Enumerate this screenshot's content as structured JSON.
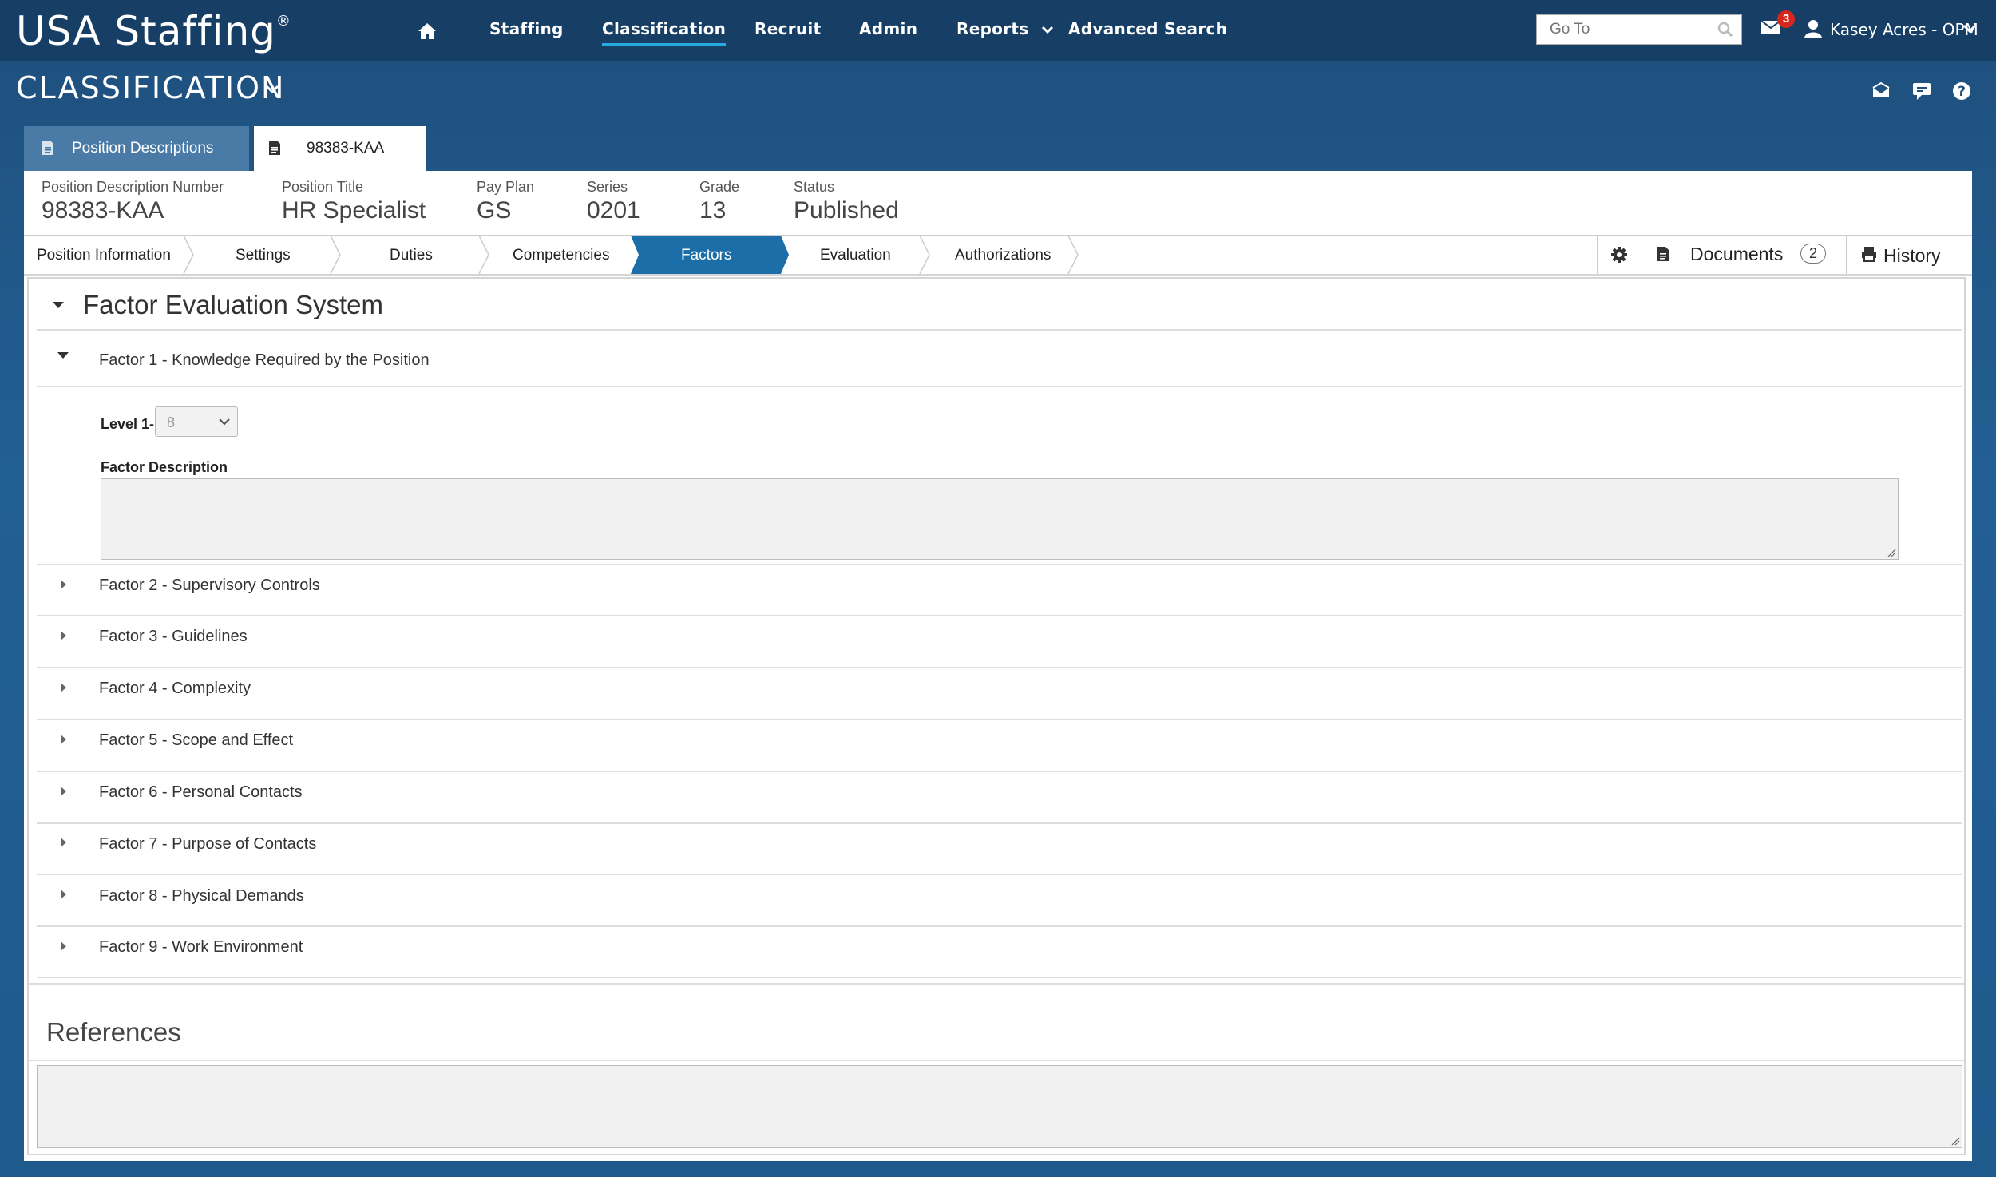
{
  "app": {
    "logo": "USA Staffing",
    "logo_mark": "®"
  },
  "nav": {
    "items": [
      "Staffing",
      "Classification",
      "Recruit",
      "Admin",
      "Reports",
      "Advanced Search"
    ],
    "active": "Classification",
    "goto_placeholder": "Go To",
    "notification_count": "3",
    "user": "Kasey Acres - OPM"
  },
  "module": {
    "title": "CLASSIFICATION"
  },
  "tabs": {
    "list_tab": "Position Descriptions",
    "record_tab": "98383-KAA"
  },
  "position": {
    "pd_number_label": "Position Description Number",
    "pd_number": "98383-KAA",
    "title_label": "Position Title",
    "title": "HR Specialist",
    "pay_plan_label": "Pay Plan",
    "pay_plan": "GS",
    "series_label": "Series",
    "series": "0201",
    "grade_label": "Grade",
    "grade": "13",
    "status_label": "Status",
    "status": "Published"
  },
  "steps": {
    "items": [
      "Position Information",
      "Settings",
      "Duties",
      "Competencies",
      "Factors",
      "Evaluation",
      "Authorizations"
    ],
    "active": "Factors"
  },
  "tools": {
    "documents_label": "Documents",
    "documents_count": "2",
    "history_label": "History"
  },
  "fes": {
    "title": "Factor Evaluation System",
    "level_label": "Level 1-",
    "level_value": "8",
    "factor_description_label": "Factor Description",
    "factors": [
      "Factor 1 - Knowledge Required by the Position",
      "Factor 2 - Supervisory Controls",
      "Factor 3 - Guidelines",
      "Factor 4 - Complexity",
      "Factor 5 - Scope and Effect",
      "Factor 6 - Personal Contacts",
      "Factor 7 - Purpose of Contacts",
      "Factor 8 - Physical Demands",
      "Factor 9 - Work Environment"
    ]
  },
  "references": {
    "title": "References"
  },
  "colors": {
    "nav_bg": "#173f66",
    "page_bg": "#225f93",
    "active_step": "#1b6ea8",
    "accent_underline": "#2aa8e0",
    "badge": "#d9261c"
  }
}
